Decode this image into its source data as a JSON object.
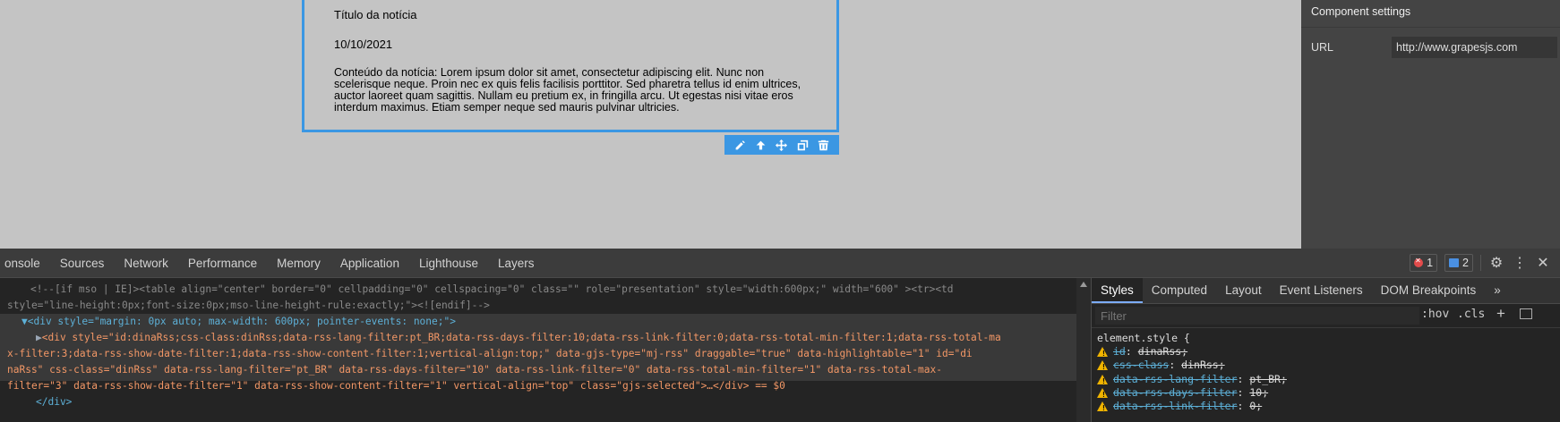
{
  "canvas": {
    "rss": {
      "title": "Título da notícia",
      "date": "10/10/2021",
      "content": "Conteúdo da notícia: Lorem ipsum dolor sit amet, consectetur adipiscing elit. Nunc non scelerisque neque. Proin nec ex quis felis facilisis porttitor. Sed pharetra tellus id enim ultrices, auctor laoreet quam sagittis. Nullam eu pretium ex, in fringilla arcu. Ut egestas nisi vitae eros interdum maximus. Etiam semper neque sed mauris pulvinar ultricies."
    },
    "toolbar": [
      "pencil-icon",
      "arrow-up-icon",
      "move-icon",
      "clone-icon",
      "trash-icon"
    ]
  },
  "settings": {
    "header": "Component settings",
    "trait_label": "URL",
    "trait_value": "http://www.grapesjs.com"
  },
  "devtools": {
    "tabs": [
      "onsole",
      "Sources",
      "Network",
      "Performance",
      "Memory",
      "Application",
      "Lighthouse",
      "Layers"
    ],
    "error_count": "1",
    "message_count": "2",
    "elements": {
      "comment_line_1": "<!--[if mso | IE]><table align=\"center\" border=\"0\" cellpadding=\"0\" cellspacing=\"0\" class=\"\" role=\"presentation\" style=\"width:600px;\" width=\"600\" ><tr><td",
      "comment_line_2": "style=\"line-height:0px;font-size:0px;mso-line-height-rule:exactly;\"><![endif]-->",
      "div_open": "<div style=\"margin: 0px auto; max-width: 600px; pointer-events: none;\">",
      "selected_line_1": "<div style=\"id:dinaRss;css-class:dinRss;data-rss-lang-filter:pt_BR;data-rss-days-filter:10;data-rss-link-filter:0;data-rss-total-min-filter:1;data-rss-total-ma",
      "selected_line_2": "x-filter:3;data-rss-show-date-filter:1;data-rss-show-content-filter:1;vertical-align:top;\" data-gjs-type=\"mj-rss\" draggable=\"true\" data-highlightable=\"1\" id=\"di",
      "selected_line_3": "naRss\" css-class=\"dinRss\" data-rss-lang-filter=\"pt_BR\" data-rss-days-filter=\"10\" data-rss-link-filter=\"0\" data-rss-total-min-filter=\"1\" data-rss-total-max-",
      "selected_line_4": "filter=\"3\" data-rss-show-date-filter=\"1\" data-rss-show-content-filter=\"1\" vertical-align=\"top\" class=\"gjs-selected\">…</div> == $0",
      "div_close": "</div>"
    },
    "styles_tabs": [
      "Styles",
      "Computed",
      "Layout",
      "Event Listeners",
      "DOM Breakpoints"
    ],
    "filter_placeholder": "Filter",
    "hov": ":hov",
    "cls": ".cls",
    "rule_head": "element.style {",
    "declarations": [
      {
        "prop": "id",
        "val": "dinaRss;"
      },
      {
        "prop": "css-class",
        "val": "dinRss;"
      },
      {
        "prop": "data-rss-lang-filter",
        "val": "pt_BR;"
      },
      {
        "prop": "data-rss-days-filter",
        "val": "10;"
      },
      {
        "prop": "data-rss-link-filter",
        "val": "0;"
      }
    ]
  }
}
